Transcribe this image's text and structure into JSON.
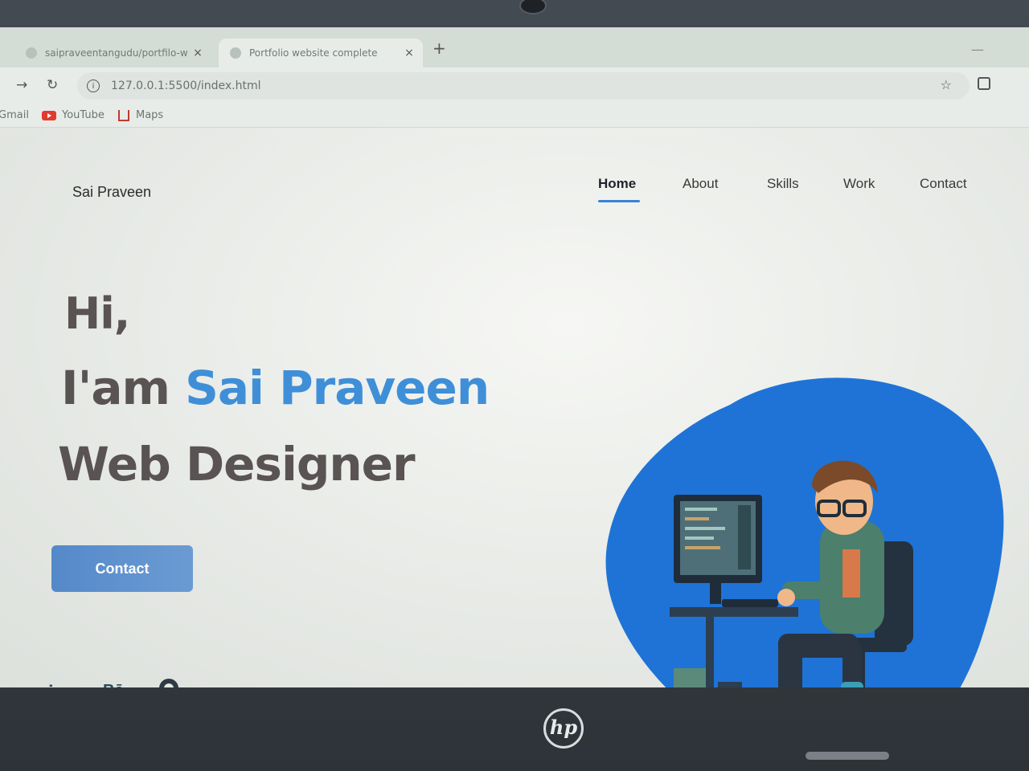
{
  "browser": {
    "tabs": [
      {
        "title": "saipraveentangudu/portfilo-w",
        "active": false
      },
      {
        "title": "Portfolio website complete",
        "active": true
      }
    ],
    "new_tab_symbol": "+",
    "close_symbol": "×",
    "address_url": "127.0.0.1:5500/index.html",
    "bookmarks": [
      "Gmail",
      "YouTube",
      "Maps"
    ]
  },
  "site": {
    "logo": "Sai Praveen",
    "nav": [
      "Home",
      "About",
      "Skills",
      "Work",
      "Contact"
    ],
    "active_nav": "Home",
    "hero": {
      "greeting": "Hi,",
      "intro_prefix": "I'am ",
      "name": "Sai Praveen",
      "role": "Web Designer"
    },
    "contact_button": "Contact",
    "social": {
      "linkedin": "in",
      "behance": "Bē",
      "github": "github-icon"
    },
    "illustration": "developer-at-desk-illustration"
  },
  "device": {
    "brand_logo": "hp"
  },
  "colors": {
    "accent": "#3f8fd8",
    "blob": "#1f73d6",
    "button": "#5489c9",
    "heading": "#5a5353"
  }
}
